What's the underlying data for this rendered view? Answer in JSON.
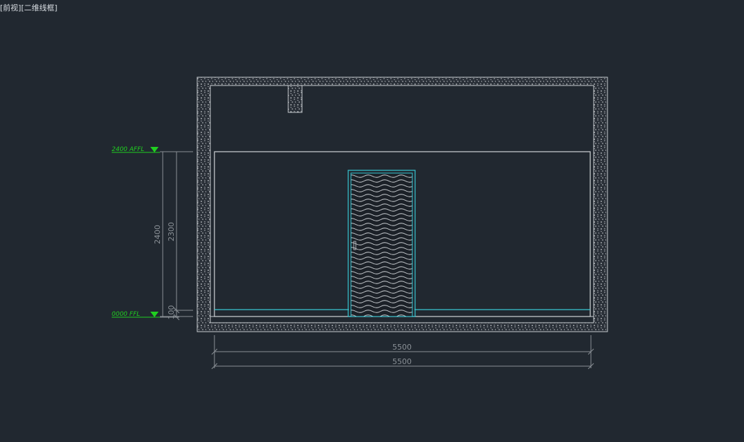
{
  "viewport": {
    "label": "[前视][二维线框]"
  },
  "colors": {
    "background": "#212830",
    "wall_line": "#c8ccd0",
    "level_marker": "#20d020",
    "cyan": "#38c8d4",
    "dimension": "#8a9096"
  },
  "levels": {
    "top": {
      "label": "2400  AFFL"
    },
    "bottom": {
      "label": "0000 FFL"
    }
  },
  "dimensions": {
    "height_total": "2400",
    "height_inner": "2300",
    "height_base": "100",
    "width_inner": "5500",
    "width_outer": "5500"
  },
  "door": {
    "pattern": "wave-hatch"
  }
}
